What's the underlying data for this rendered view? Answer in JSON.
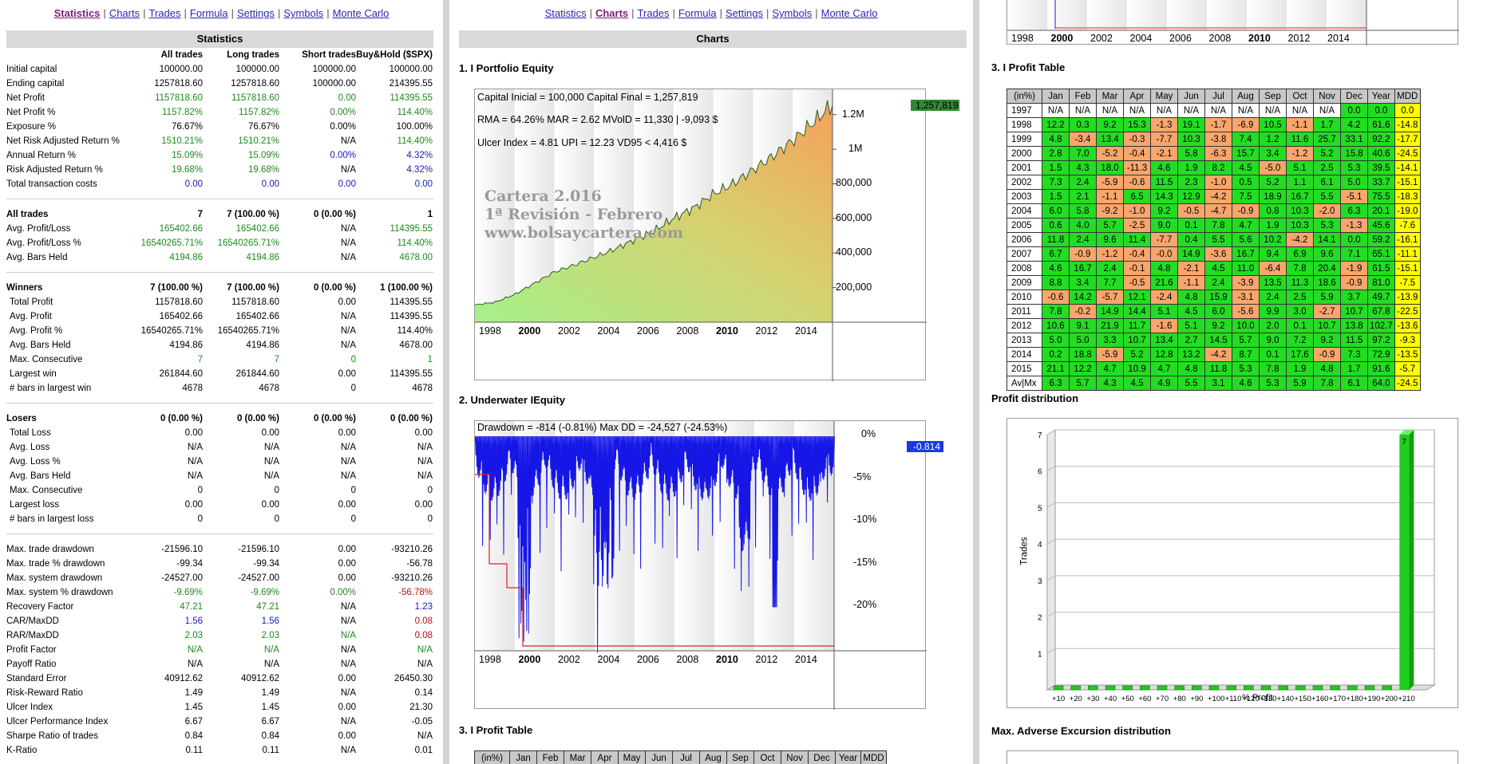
{
  "nav": {
    "items": [
      "Statistics",
      "Charts",
      "Trades",
      "Formula",
      "Settings",
      "Symbols",
      "Monte Carlo"
    ]
  },
  "stats": {
    "title": "Statistics",
    "headers": [
      "",
      "All trades",
      "Long trades",
      "Short trades",
      "Buy&Hold ($SPX)"
    ],
    "groups": [
      {
        "rows": [
          [
            "Initial capital",
            "100000.00",
            "100000.00",
            "100000.00",
            "100000.00",
            ""
          ],
          [
            "Ending capital",
            "1257818.60",
            "1257818.60",
            "100000.00",
            "214395.55",
            ""
          ],
          [
            "Net Profit",
            "1157818.60",
            "1157818.60",
            "0.00",
            "114395.55",
            "g"
          ],
          [
            "Net Profit %",
            "1157.82%",
            "1157.82%",
            "0.00%",
            "114.40%",
            "g"
          ],
          [
            "Exposure %",
            "76.67%",
            "76.67%",
            "0.00%",
            "100.00%",
            ""
          ],
          [
            "Net Risk Adjusted Return %",
            "1510.21%",
            "1510.21%",
            "N/A",
            "114.40%",
            "g"
          ],
          [
            "Annual Return %",
            "15.09%",
            "15.09%",
            "0.00%",
            "4.32%",
            "gb"
          ],
          [
            "Risk Adjusted Return %",
            "19.68%",
            "19.68%",
            "N/A",
            "4.32%",
            "gb"
          ],
          [
            "Total transaction costs",
            "0.00",
            "0.00",
            "0.00",
            "0.00",
            "b"
          ]
        ]
      },
      {
        "rows": [
          [
            "All trades",
            "7",
            "7 (100.00 %)",
            "0 (0.00 %)",
            "1",
            "h"
          ],
          [
            "Avg. Profit/Loss",
            "165402.66",
            "165402.66",
            "N/A",
            "114395.55",
            "g"
          ],
          [
            "Avg. Profit/Loss %",
            "16540265.71%",
            "16540265.71%",
            "N/A",
            "114.40%",
            "g"
          ],
          [
            "Avg. Bars Held",
            "4194.86",
            "4194.86",
            "N/A",
            "4678.00",
            "g"
          ]
        ]
      },
      {
        "rows": [
          [
            "Winners",
            "7 (100.00 %)",
            "7 (100.00 %)",
            "0 (0.00 %)",
            "1 (100.00 %)",
            "h"
          ],
          [
            "Total Profit",
            "1157818.60",
            "1157818.60",
            "0.00",
            "114395.55",
            ""
          ],
          [
            "Avg. Profit",
            "165402.66",
            "165402.66",
            "N/A",
            "114395.55",
            ""
          ],
          [
            "Avg. Profit %",
            "16540265.71%",
            "16540265.71%",
            "N/A",
            "114.40%",
            ""
          ],
          [
            "Avg. Bars Held",
            "4194.86",
            "4194.86",
            "N/A",
            "4678.00",
            ""
          ],
          [
            "Max. Consecutive",
            "7",
            "7",
            "0",
            "1",
            "g"
          ],
          [
            "Largest win",
            "261844.60",
            "261844.60",
            "0.00",
            "114395.55",
            ""
          ],
          [
            "# bars in largest win",
            "4678",
            "4678",
            "0",
            "4678",
            ""
          ]
        ]
      },
      {
        "rows": [
          [
            "Losers",
            "0 (0.00 %)",
            "0 (0.00 %)",
            "0 (0.00 %)",
            "0 (0.00 %)",
            "h"
          ],
          [
            "Total Loss",
            "0.00",
            "0.00",
            "0.00",
            "0.00",
            ""
          ],
          [
            "Avg. Loss",
            "N/A",
            "N/A",
            "N/A",
            "N/A",
            ""
          ],
          [
            "Avg. Loss %",
            "N/A",
            "N/A",
            "N/A",
            "N/A",
            ""
          ],
          [
            "Avg. Bars Held",
            "N/A",
            "N/A",
            "N/A",
            "N/A",
            ""
          ],
          [
            "Max. Consecutive",
            "0",
            "0",
            "0",
            "0",
            ""
          ],
          [
            "Largest loss",
            "0.00",
            "0.00",
            "0.00",
            "0.00",
            ""
          ],
          [
            "# bars in largest loss",
            "0",
            "0",
            "0",
            "0",
            ""
          ]
        ]
      },
      {
        "rows": [
          [
            "Max. trade drawdown",
            "-21596.10",
            "-21596.10",
            "0.00",
            "-93210.26",
            ""
          ],
          [
            "Max. trade % drawdown",
            "-99.34",
            "-99.34",
            "0.00",
            "-56.78",
            ""
          ],
          [
            "Max. system drawdown",
            "-24527.00",
            "-24527.00",
            "0.00",
            "-93210.26",
            ""
          ],
          [
            "Max. system % drawdown",
            "-9.69%",
            "-9.69%",
            "0.00%",
            "-56.78%",
            "gr"
          ],
          [
            "Recovery Factor",
            "47.21",
            "47.21",
            "N/A",
            "1.23",
            "gb"
          ],
          [
            "CAR/MaxDD",
            "1.56",
            "1.56",
            "N/A",
            "0.08",
            "br"
          ],
          [
            "RAR/MaxDD",
            "2.03",
            "2.03",
            "N/A",
            "0.08",
            "gr"
          ],
          [
            "Profit Factor",
            "N/A",
            "N/A",
            "N/A",
            "N/A",
            "g"
          ],
          [
            "Payoff Ratio",
            "N/A",
            "N/A",
            "N/A",
            "N/A",
            ""
          ],
          [
            "Standard Error",
            "40912.62",
            "40912.62",
            "0.00",
            "26450.30",
            ""
          ],
          [
            "Risk-Reward Ratio",
            "1.49",
            "1.49",
            "N/A",
            "0.14",
            ""
          ],
          [
            "Ulcer Index",
            "1.45",
            "1.45",
            "0.00",
            "21.30",
            ""
          ],
          [
            "Ulcer Performance Index",
            "6.67",
            "6.67",
            "N/A",
            "-0.05",
            ""
          ],
          [
            "Sharpe Ratio of trades",
            "0.84",
            "0.84",
            "0.00",
            "N/A",
            ""
          ],
          [
            "K-Ratio",
            "0.11",
            "0.11",
            "N/A",
            "0.01",
            ""
          ]
        ]
      }
    ]
  },
  "charts": {
    "title": "Charts",
    "sec1": "1. I Portfolio Equity",
    "sec2": "2. Underwater IEquity",
    "sec3": "3. I Profit Table",
    "equity": {
      "line1": "Capital Inicial = 100,000  Capital Final = 1,257,819",
      "line2": "RMA = 64.26%   MAR = 2.62   MVolD = 11,330 | -9,093 $",
      "line3": "Ulcer Index = 4.81   UPI = 12.23   VD95 < 4,416 $",
      "watermark1": "Cartera 2.016",
      "watermark2": "1ª Revisión - Febrero",
      "watermark3": "www.bolsaycartera.com",
      "last_label": "1,257,819",
      "yticks": [
        "1.2M",
        "1M",
        "800,000",
        "600,000",
        "400,000",
        "200,000"
      ]
    },
    "underwater": {
      "line1": "Drawdown = -814 (-0.81%)     Max DD = -24,527 (-24.53%)",
      "last_label": "-0.814",
      "yticks": [
        "0%",
        "-5%",
        "-10%",
        "-15%",
        "-20%"
      ]
    },
    "xticks": [
      "1998",
      "2000",
      "2002",
      "2004",
      "2006",
      "2008",
      "2010",
      "2012",
      "2014"
    ]
  },
  "right": {
    "sec3": "3. I Profit Table",
    "sec_dist": "Profit distribution",
    "sec_mae": "Max. Adverse Excursion distribution",
    "table_headers": [
      "(in%)",
      "Jan",
      "Feb",
      "Mar",
      "Apr",
      "May",
      "Jun",
      "Jul",
      "Aug",
      "Sep",
      "Oct",
      "Nov",
      "Dec",
      "Year",
      "MDD"
    ],
    "table_rows": [
      [
        "1997",
        "N/A",
        "N/A",
        "N/A",
        "N/A",
        "N/A",
        "N/A",
        "N/A",
        "N/A",
        "N/A",
        "N/A",
        "N/A",
        "0.0",
        "0.0",
        "0.0"
      ],
      [
        "1998",
        "12.2",
        "0.3",
        "9.2",
        "15.3",
        "-1.3",
        "19.1",
        "-1.7",
        "-6.9",
        "10.5",
        "-1.1",
        "1.7",
        "4.2",
        "61.6",
        "-14.8"
      ],
      [
        "1999",
        "4.8",
        "-3.4",
        "13.4",
        "-0.3",
        "-7.7",
        "10.3",
        "-3.8",
        "7.4",
        "1.2",
        "11.6",
        "25.7",
        "33.1",
        "92.2",
        "-17.7"
      ],
      [
        "2000",
        "2.8",
        "7.0",
        "-5.2",
        "-0.4",
        "-2.1",
        "5.8",
        "-6.3",
        "15.7",
        "3.4",
        "-1.2",
        "5.2",
        "15.8",
        "40.6",
        "-24.5"
      ],
      [
        "2001",
        "1.5",
        "4.3",
        "18.0",
        "-11.3",
        "4.6",
        "1.9",
        "8.2",
        "4.5",
        "-5.0",
        "5.1",
        "2.5",
        "5.3",
        "39.5",
        "-14.1"
      ],
      [
        "2002",
        "7.3",
        "2.4",
        "-5.9",
        "-0.6",
        "11.5",
        "2.3",
        "-1.0",
        "0.5",
        "5.2",
        "1.1",
        "6.1",
        "5.0",
        "33.7",
        "-15.1"
      ],
      [
        "2003",
        "1.5",
        "2.1",
        "-1.1",
        "6.5",
        "14.3",
        "12.9",
        "-4.2",
        "7.5",
        "18.9",
        "16.7",
        "5.5",
        "-5.1",
        "75.5",
        "-18.3"
      ],
      [
        "2004",
        "6.0",
        "5.8",
        "-9.2",
        "-1.0",
        "9.2",
        "-0.5",
        "-4.7",
        "-0.9",
        "0.8",
        "10.3",
        "-2.0",
        "6.3",
        "20.1",
        "-19.0"
      ],
      [
        "2005",
        "0.6",
        "4.0",
        "5.7",
        "-2.5",
        "9.0",
        "0.1",
        "7.8",
        "4.7",
        "1.9",
        "10.3",
        "5.3",
        "-1.3",
        "45.6",
        "-7.6"
      ],
      [
        "2006",
        "11.8",
        "2.4",
        "9.6",
        "11.4",
        "-7.7",
        "0.4",
        "5.5",
        "5.6",
        "10.2",
        "-4.2",
        "14.1",
        "0.0",
        "59.2",
        "-16.1"
      ],
      [
        "2007",
        "6.7",
        "-0.9",
        "-1.2",
        "-0.4",
        "-0.0",
        "14.9",
        "-3.6",
        "16.7",
        "9.4",
        "6.9",
        "9.6",
        "7.1",
        "65.1",
        "-11.1"
      ],
      [
        "2008",
        "4.6",
        "16.7",
        "2.4",
        "-0.1",
        "4.8",
        "-2.1",
        "4.5",
        "11.0",
        "-6.4",
        "7.8",
        "20.4",
        "-1.9",
        "61.5",
        "-15.1"
      ],
      [
        "2009",
        "8.8",
        "3.4",
        "7.7",
        "-0.5",
        "21.6",
        "-1.1",
        "2.4",
        "-3.9",
        "13.5",
        "11.3",
        "18.6",
        "-0.9",
        "81.0",
        "-7.5"
      ],
      [
        "2010",
        "-0.6",
        "14.2",
        "-5.7",
        "12.1",
        "-2.4",
        "4.8",
        "15.9",
        "-3.1",
        "2.4",
        "2.5",
        "5.9",
        "3.7",
        "49.7",
        "-13.9"
      ],
      [
        "2011",
        "7.8",
        "-0.2",
        "14.9",
        "14.4",
        "5.1",
        "4.5",
        "6.0",
        "-5.6",
        "9.9",
        "3.0",
        "-2.7",
        "10.7",
        "67.8",
        "-22.5"
      ],
      [
        "2012",
        "10.6",
        "9.1",
        "21.9",
        "11.7",
        "-1.6",
        "5.1",
        "9.2",
        "10.0",
        "2.0",
        "0.1",
        "10.7",
        "13.8",
        "102.7",
        "-13.6"
      ],
      [
        "2013",
        "5.0",
        "5.0",
        "3.3",
        "10.7",
        "13.4",
        "2.7",
        "14.5",
        "5.7",
        "9.0",
        "7.2",
        "9.2",
        "11.5",
        "97.2",
        "-9.3"
      ],
      [
        "2014",
        "0.2",
        "18.8",
        "-5.9",
        "5.2",
        "12.8",
        "13.2",
        "-4.2",
        "8.7",
        "0.1",
        "17.6",
        "-0.9",
        "7.3",
        "72.9",
        "-13.5"
      ],
      [
        "2015",
        "21.1",
        "12.2",
        "4.7",
        "10.9",
        "4.7",
        "4.8",
        "11.8",
        "5.3",
        "7.8",
        "1.9",
        "4.8",
        "1.7",
        "91.6",
        "-5.7"
      ],
      [
        "Av|Mx",
        "6.3",
        "5.7",
        "4.3",
        "4.5",
        "4.9",
        "5.5",
        "3.1",
        "4.6",
        "5.3",
        "5.9",
        "7.8",
        "6.1",
        "64.0",
        "-24.5"
      ]
    ],
    "dist": {
      "ylabel": "Trades",
      "xlabel": "% Profit",
      "yticks": [
        "7",
        "6",
        "5",
        "4",
        "3",
        "2",
        "1"
      ],
      "xticks": [
        "+10",
        "+20",
        "+30",
        "+40",
        "+50",
        "+60",
        "+70",
        "+80",
        "+90",
        "+100",
        "+110",
        "+120",
        "+130",
        "+140",
        "+150",
        "+160",
        "+170",
        "+180",
        "+190",
        "+200",
        "+210"
      ],
      "bar_label": "7"
    },
    "top_xticks": [
      "1998",
      "2000",
      "2002",
      "2004",
      "2006",
      "2008",
      "2010",
      "2012",
      "2014"
    ]
  },
  "chart_data": [
    {
      "type": "area",
      "title": "",
      "series": [
        {
          "name": "",
          "x": [
            1997,
            1998,
            1999,
            2000,
            2001,
            2002,
            2003,
            2004,
            2005,
            2006,
            2007,
            2008,
            2009,
            2010,
            2011,
            2012,
            2013,
            2014,
            2015
          ],
          "values": [
            100000,
            115000,
            160000,
            225000,
            290000,
            330000,
            375000,
            420000,
            475000,
            525000,
            600000,
            660000,
            740000,
            800000,
            880000,
            960000,
            1050000,
            1150000,
            1257819
          ]
        }
      ],
      "ylim": [
        0,
        1300000
      ]
    },
    {
      "type": "area",
      "title": "",
      "series": [
        {
          "name": "",
          "values": [
            0,
            -5,
            -15,
            -24.5,
            -8,
            -12,
            -20,
            -6,
            -10,
            -4,
            -14,
            -9,
            -18,
            -7,
            -23,
            -10,
            -8,
            -5,
            -0.81
          ]
        }
      ],
      "ylim": [
        -25,
        0
      ]
    },
    {
      "type": "bar",
      "title": "",
      "categories": [
        "+10",
        "+20",
        "+30",
        "+40",
        "+50",
        "+60",
        "+70",
        "+80",
        "+90",
        "+100",
        "+110",
        "+120",
        "+130",
        "+140",
        "+150",
        "+160",
        "+170",
        "+180",
        "+190",
        "+200",
        "+210"
      ],
      "values": [
        0,
        0,
        0,
        0,
        0,
        0,
        0,
        0,
        0,
        0,
        0,
        0,
        0,
        0,
        0,
        0,
        0,
        0,
        0,
        0,
        7
      ],
      "xlabel": "% Profit",
      "ylabel": "Trades",
      "ylim": [
        0,
        7
      ]
    }
  ]
}
